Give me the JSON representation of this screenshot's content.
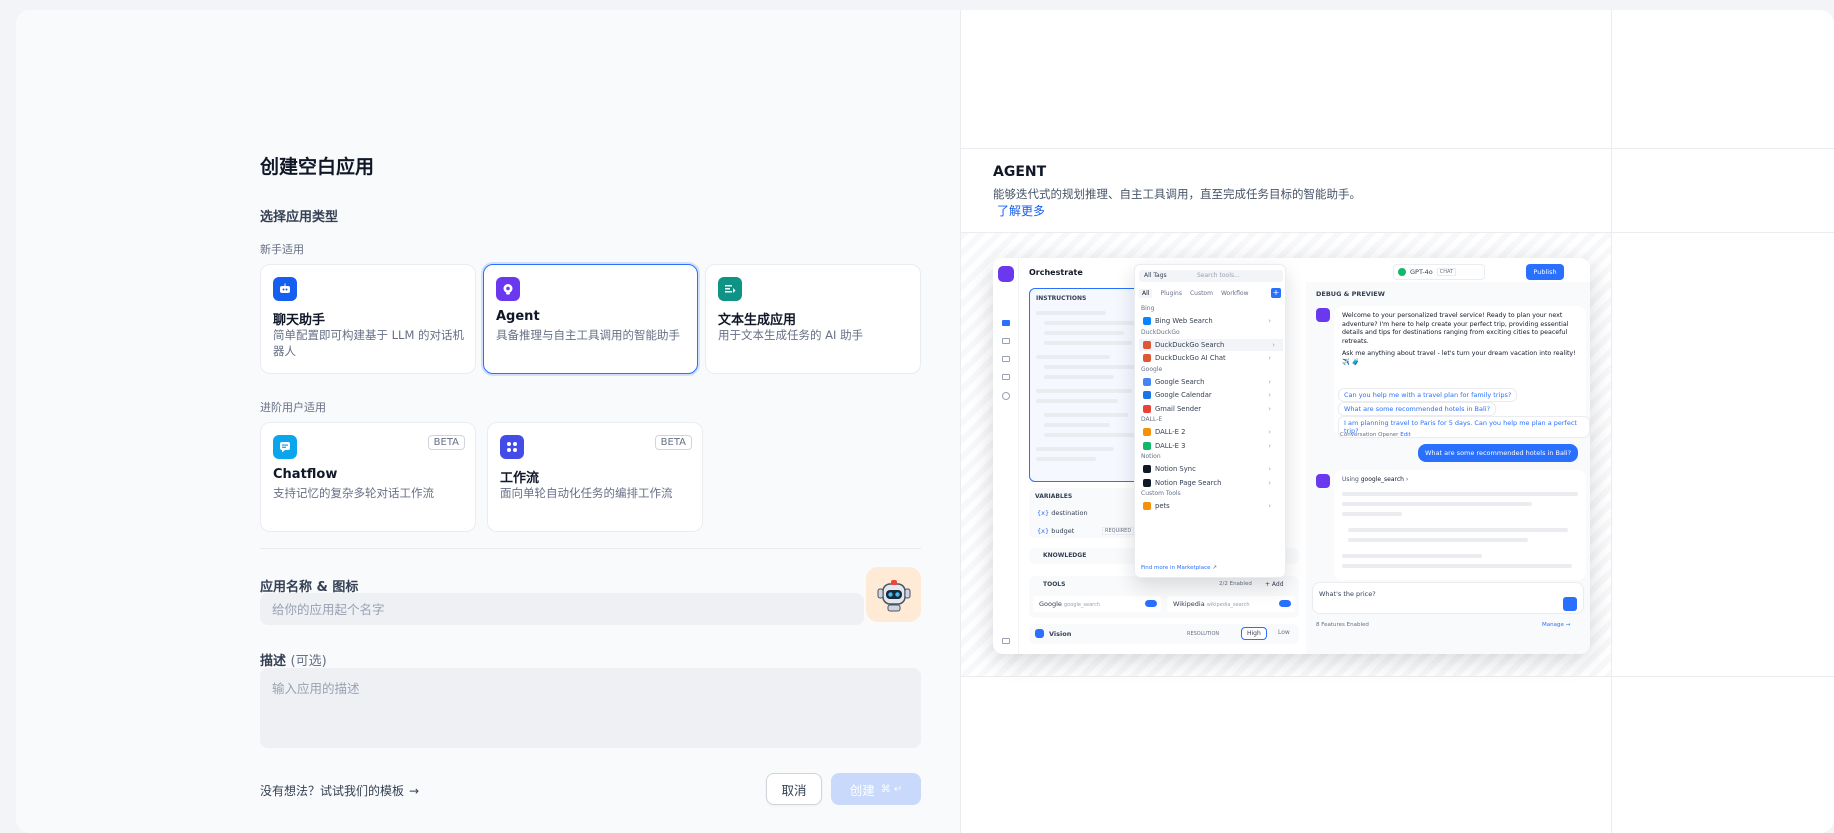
{
  "left": {
    "title": "创建空白应用",
    "select_type": "选择应用类型",
    "beginner_group": "新手适用",
    "advanced_group": "进阶用户适用",
    "cards": [
      {
        "id": "chat",
        "title": "聊天助手",
        "desc": "简单配置即可构建基于 LLM 的对话机器人",
        "color": "#155eef"
      },
      {
        "id": "agent",
        "title": "Agent",
        "desc": "具备推理与自主工具调用的智能助手",
        "color": "#6938ef"
      },
      {
        "id": "completion",
        "title": "文本生成应用",
        "desc": "用于文本生成任务的 AI 助手",
        "color": "#0e9384"
      },
      {
        "id": "chatflow",
        "title": "Chatflow",
        "desc": "支持记忆的复杂多轮对话工作流",
        "color": "#0ba5ec",
        "badge": "BETA"
      },
      {
        "id": "workflow",
        "title": "工作流",
        "desc": "面向单轮自动化任务的编排工作流",
        "color": "#444ce7",
        "badge": "BETA"
      }
    ],
    "name_label": "应用名称 & 图标",
    "name_placeholder": "给你的应用起个名字",
    "desc_label": "描述",
    "desc_optional": "(可选)",
    "desc_placeholder": "输入应用的描述",
    "template_link": "没有想法？试试我们的模板",
    "cancel": "取消",
    "create": "创建"
  },
  "right": {
    "heading": "AGENT",
    "desc": "能够迭代式的规划推理、自主工具调用，直至完成任务目标的智能助手。",
    "learn_more": "了解更多"
  },
  "preview": {
    "orchestrate": "Orchestrate",
    "instructions": "INSTRUCTIONS",
    "variables": "VARIABLES",
    "var_destination": "destination",
    "var_budget": "budget",
    "required": "REQUIRED",
    "knowledge": "KNOWLEDGE",
    "tools": "TOOLS",
    "tools_enabled": "2/2 Enabled",
    "add": "+ Add",
    "tool_google": "Google",
    "tool_google_id": "google_search",
    "tool_wiki": "Wikipedia",
    "tool_wiki_id": "wikipedia_search",
    "vision": "Vision",
    "resolution": "RESOLUTION",
    "high": "High",
    "low": "Low",
    "all_tags": "All Tags",
    "search_tools": "Search tools...",
    "tabs": [
      "All",
      "Plugins",
      "Custom",
      "Workflow"
    ],
    "menu": [
      {
        "type": "label",
        "text": "Bing"
      },
      {
        "type": "item",
        "text": "Bing Web Search",
        "color": "#0a84ff"
      },
      {
        "type": "label",
        "text": "DuckDuckGo"
      },
      {
        "type": "item",
        "text": "DuckDuckGo Search",
        "color": "#de5833",
        "active": true
      },
      {
        "type": "item",
        "text": "DuckDuckGo AI Chat",
        "color": "#de5833"
      },
      {
        "type": "label",
        "text": "Google"
      },
      {
        "type": "item",
        "text": "Google Search",
        "color": "#4285f4"
      },
      {
        "type": "item",
        "text": "Google Calendar",
        "color": "#1a73e8"
      },
      {
        "type": "item",
        "text": "Gmail Sender",
        "color": "#ea4335"
      },
      {
        "type": "label",
        "text": "DALL-E"
      },
      {
        "type": "item",
        "text": "DALL-E 2",
        "color": "#f79009"
      },
      {
        "type": "item",
        "text": "DALL-E 3",
        "color": "#12b76a"
      },
      {
        "type": "label",
        "text": "Notion"
      },
      {
        "type": "item",
        "text": "Notion Sync",
        "color": "#101828"
      },
      {
        "type": "item",
        "text": "Notion Page Search",
        "color": "#101828"
      },
      {
        "type": "label",
        "text": "Custom Tools"
      },
      {
        "type": "item",
        "text": "pets",
        "color": "#f79009"
      }
    ],
    "find_more": "Find more in",
    "marketplace": "Marketplace ↗",
    "model": "GPT-4o",
    "chat_tag": "CHAT",
    "publish": "Publish",
    "debug": "DEBUG & PREVIEW",
    "welcome": "Welcome to your personalized travel service! Ready to plan your next adventure? I'm here to help create your perfect trip, providing essential details and tips for destinations ranging from exciting cities to peaceful retreats.",
    "ask": "Ask me anything about travel - let's turn your dream vacation into reality! ✈️ 🧳",
    "suggestions": [
      "Can you help me with a travel plan for family trips?",
      "What are some recommended hotels in Bali?",
      "I am planning travel to Paris for 5 days. Can you help me plan a perfect trip?"
    ],
    "opener": "Conversation Opener",
    "edit": "Edit",
    "user_msg": "What are some recommended hotels in Bali?",
    "using": "Using",
    "using_tool": "google_search",
    "input_text": "What's the price?",
    "features": "8 Features Enabled",
    "manage": "Manage →"
  }
}
